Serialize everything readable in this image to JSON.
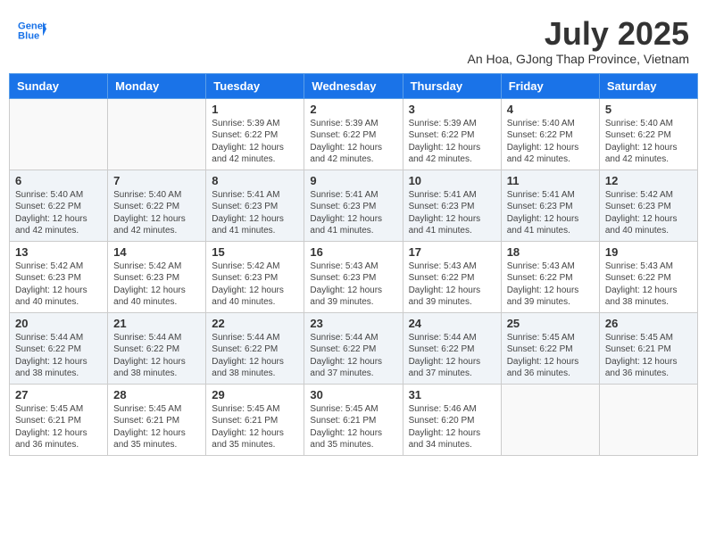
{
  "logo": {
    "line1": "General",
    "line2": "Blue"
  },
  "title": "July 2025",
  "subtitle": "An Hoa, GJong Thap Province, Vietnam",
  "days_of_week": [
    "Sunday",
    "Monday",
    "Tuesday",
    "Wednesday",
    "Thursday",
    "Friday",
    "Saturday"
  ],
  "weeks": [
    [
      {
        "day": "",
        "info": ""
      },
      {
        "day": "",
        "info": ""
      },
      {
        "day": "1",
        "info": "Sunrise: 5:39 AM\nSunset: 6:22 PM\nDaylight: 12 hours and 42 minutes."
      },
      {
        "day": "2",
        "info": "Sunrise: 5:39 AM\nSunset: 6:22 PM\nDaylight: 12 hours and 42 minutes."
      },
      {
        "day": "3",
        "info": "Sunrise: 5:39 AM\nSunset: 6:22 PM\nDaylight: 12 hours and 42 minutes."
      },
      {
        "day": "4",
        "info": "Sunrise: 5:40 AM\nSunset: 6:22 PM\nDaylight: 12 hours and 42 minutes."
      },
      {
        "day": "5",
        "info": "Sunrise: 5:40 AM\nSunset: 6:22 PM\nDaylight: 12 hours and 42 minutes."
      }
    ],
    [
      {
        "day": "6",
        "info": "Sunrise: 5:40 AM\nSunset: 6:22 PM\nDaylight: 12 hours and 42 minutes."
      },
      {
        "day": "7",
        "info": "Sunrise: 5:40 AM\nSunset: 6:22 PM\nDaylight: 12 hours and 42 minutes."
      },
      {
        "day": "8",
        "info": "Sunrise: 5:41 AM\nSunset: 6:23 PM\nDaylight: 12 hours and 41 minutes."
      },
      {
        "day": "9",
        "info": "Sunrise: 5:41 AM\nSunset: 6:23 PM\nDaylight: 12 hours and 41 minutes."
      },
      {
        "day": "10",
        "info": "Sunrise: 5:41 AM\nSunset: 6:23 PM\nDaylight: 12 hours and 41 minutes."
      },
      {
        "day": "11",
        "info": "Sunrise: 5:41 AM\nSunset: 6:23 PM\nDaylight: 12 hours and 41 minutes."
      },
      {
        "day": "12",
        "info": "Sunrise: 5:42 AM\nSunset: 6:23 PM\nDaylight: 12 hours and 40 minutes."
      }
    ],
    [
      {
        "day": "13",
        "info": "Sunrise: 5:42 AM\nSunset: 6:23 PM\nDaylight: 12 hours and 40 minutes."
      },
      {
        "day": "14",
        "info": "Sunrise: 5:42 AM\nSunset: 6:23 PM\nDaylight: 12 hours and 40 minutes."
      },
      {
        "day": "15",
        "info": "Sunrise: 5:42 AM\nSunset: 6:23 PM\nDaylight: 12 hours and 40 minutes."
      },
      {
        "day": "16",
        "info": "Sunrise: 5:43 AM\nSunset: 6:23 PM\nDaylight: 12 hours and 39 minutes."
      },
      {
        "day": "17",
        "info": "Sunrise: 5:43 AM\nSunset: 6:22 PM\nDaylight: 12 hours and 39 minutes."
      },
      {
        "day": "18",
        "info": "Sunrise: 5:43 AM\nSunset: 6:22 PM\nDaylight: 12 hours and 39 minutes."
      },
      {
        "day": "19",
        "info": "Sunrise: 5:43 AM\nSunset: 6:22 PM\nDaylight: 12 hours and 38 minutes."
      }
    ],
    [
      {
        "day": "20",
        "info": "Sunrise: 5:44 AM\nSunset: 6:22 PM\nDaylight: 12 hours and 38 minutes."
      },
      {
        "day": "21",
        "info": "Sunrise: 5:44 AM\nSunset: 6:22 PM\nDaylight: 12 hours and 38 minutes."
      },
      {
        "day": "22",
        "info": "Sunrise: 5:44 AM\nSunset: 6:22 PM\nDaylight: 12 hours and 38 minutes."
      },
      {
        "day": "23",
        "info": "Sunrise: 5:44 AM\nSunset: 6:22 PM\nDaylight: 12 hours and 37 minutes."
      },
      {
        "day": "24",
        "info": "Sunrise: 5:44 AM\nSunset: 6:22 PM\nDaylight: 12 hours and 37 minutes."
      },
      {
        "day": "25",
        "info": "Sunrise: 5:45 AM\nSunset: 6:22 PM\nDaylight: 12 hours and 36 minutes."
      },
      {
        "day": "26",
        "info": "Sunrise: 5:45 AM\nSunset: 6:21 PM\nDaylight: 12 hours and 36 minutes."
      }
    ],
    [
      {
        "day": "27",
        "info": "Sunrise: 5:45 AM\nSunset: 6:21 PM\nDaylight: 12 hours and 36 minutes."
      },
      {
        "day": "28",
        "info": "Sunrise: 5:45 AM\nSunset: 6:21 PM\nDaylight: 12 hours and 35 minutes."
      },
      {
        "day": "29",
        "info": "Sunrise: 5:45 AM\nSunset: 6:21 PM\nDaylight: 12 hours and 35 minutes."
      },
      {
        "day": "30",
        "info": "Sunrise: 5:45 AM\nSunset: 6:21 PM\nDaylight: 12 hours and 35 minutes."
      },
      {
        "day": "31",
        "info": "Sunrise: 5:46 AM\nSunset: 6:20 PM\nDaylight: 12 hours and 34 minutes."
      },
      {
        "day": "",
        "info": ""
      },
      {
        "day": "",
        "info": ""
      }
    ]
  ]
}
